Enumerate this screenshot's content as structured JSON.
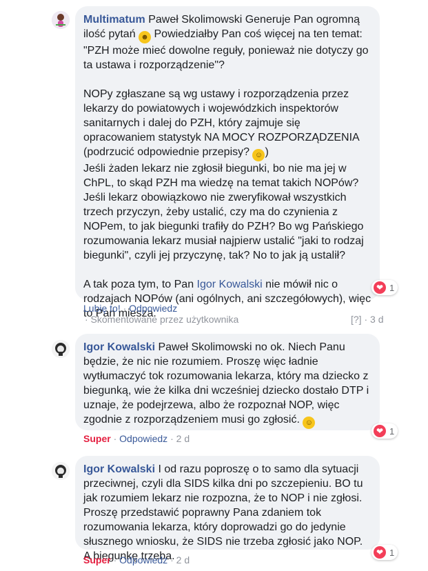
{
  "comments": [
    {
      "author": "Multimatum",
      "lines": {
        "p1_start": " Paweł Skolimowski Generuje Pan ogromną ilość pytań ",
        "p1_end": " Powiedziałby Pan coś więcej na ten temat: \"PZH może mieć dowolne reguły, ponieważ nie dotyczy go ta ustawa i rozporządzenie\"?",
        "p2_start": "NOPy zgłaszane są wg ustawy i rozporządzenia przez lekarzy do powiatowych i wojewódzkich inspektorów sanitarnych i dalej do PZH, który zajmuje się opracowaniem statystyk NA MOCY ROZPORZĄDZENIA (podrzucić odpowiednie przepisy? ",
        "p2_end": ")\nJeśli żaden lekarz nie zgłosił biegunki, bo nie ma jej w ChPL, to skąd PZH ma wiedzę na temat takich NOPów? Jeśli lekarz obowiązkowo nie zweryfikował wszystkich trzech przyczyn, żeby ustalić, czy ma do czynienia z NOPem, to jak biegunki trafiły do PZH? Bo wg Pańskiego rozumowania lekarz musiał najpierw ustalić \"jaki to rodzaj biegunki\", czyli jej przyczynę, tak? No to jak ją ustalił?",
        "p3_start": "A tak poza tym, to Pan ",
        "p3_tag": "Igor Kowalski",
        "p3_end": " nie mówił nic o rodzajach NOPów (ani ogólnych, ani szczegółowych), więc to Pan miesza."
      },
      "reactions": "1",
      "like_label": "Lubię to!",
      "reply_label": "Odpowiedz",
      "edited_note": "· Skomentowane przez użytkownika",
      "bracket_label": "[?]",
      "time": "3 d"
    },
    {
      "author": "Igor Kowalski",
      "text": " Paweł Skolimowski no ok. Niech Panu będzie, że nic nie rozumiem. Proszę więc ładnie wytłumaczyć tok rozumowania lekarza, który ma dziecko z biegunką, wie że kilka dni wcześniej dziecko dostało DTP i uznaje, że podejrzewa, albo że rozpoznał NOP, więc zgodnie z rozporządzeniem musi go zgłosić. ",
      "reactions": "1",
      "reaction_label": "Super",
      "reply_label": "Odpowiedz",
      "time": "2 d"
    },
    {
      "author": "Igor Kowalski",
      "text": " I od razu poproszę o to samo dla sytuacji przeciwnej, czyli dla SIDS kilka dni po szczepieniu. BO tu jak rozumiem lekarz nie rozpozna, że to NOP i nie zgłosi. Proszę przedstawić poprawny Pana zdaniem tok rozumowania lekarza, który doprowadzi go do jedynie słusznego wniosku, że SIDS nie trzeba zgłosić jako NOP. A biegunkę trzeba.",
      "reactions": "1",
      "reaction_label": "Super",
      "reply_label": "Odpowiedz",
      "time": "2 d"
    }
  ],
  "separator": "·",
  "colors": {
    "link": "#385898",
    "super": "#e41e3f",
    "bubble": "#f0f2f5",
    "heart": "#f33e58"
  },
  "icons": [
    "profile-photo",
    "grinning-emoji",
    "laughing-emoji",
    "smiling-emoji",
    "heart-icon"
  ]
}
